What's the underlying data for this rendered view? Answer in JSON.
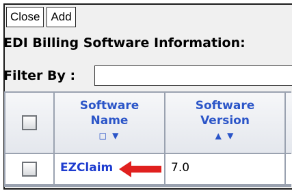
{
  "toolbar": {
    "close_label": "Close",
    "add_label": "Add"
  },
  "page_title": "EDI Billing Software Information:",
  "filter": {
    "label": "Filter By :",
    "value": ""
  },
  "table": {
    "columns": [
      {
        "line1": "Software",
        "line2": "Name",
        "sort": "□ ▼"
      },
      {
        "line1": "Software",
        "line2": "Version",
        "sort": "▲ ▼"
      }
    ],
    "rows": [
      {
        "name": "EZClaim",
        "version": "7.0",
        "selected": false
      }
    ]
  },
  "colors": {
    "header_text": "#2b55c8",
    "link": "#1d3ccf",
    "arrow": "#e0201e"
  }
}
